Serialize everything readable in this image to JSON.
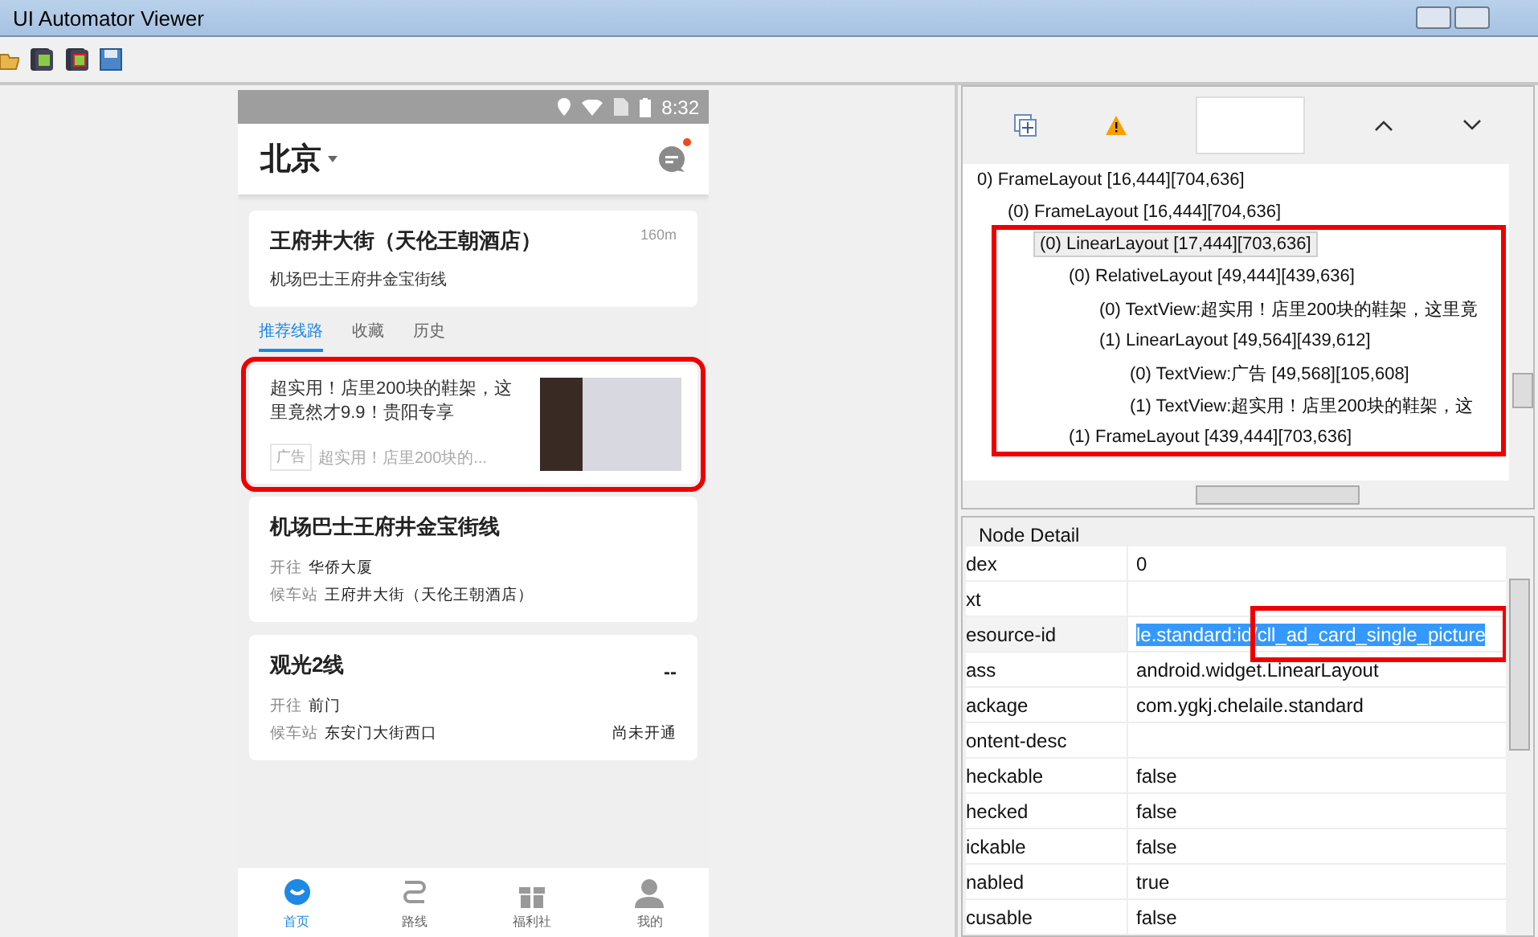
{
  "window": {
    "title": "UI Automator Viewer"
  },
  "phone": {
    "status_time": "8:32",
    "city": "北京",
    "has_notification": true,
    "nearby": {
      "stop": "王府井大街（天伦王朝酒店）",
      "distance": "160m",
      "line": "机场巴士王府井金宝街线"
    },
    "tabs": [
      {
        "label": "推荐线路",
        "selected": true
      },
      {
        "label": "收藏",
        "selected": false
      },
      {
        "label": "历史",
        "selected": false
      }
    ],
    "ad": {
      "title": "超实用！店里200块的鞋架，这里竟然才9.9！贵阳专享",
      "tag": "广告",
      "summary": "超实用！店里200块的...",
      "highlighted": true
    },
    "lines": [
      {
        "name": "机场巴士王府井金宝街线",
        "to_label": "开往",
        "to": "华侨大厦",
        "stop_label": "候车站",
        "stop": "王府井大街（天伦王朝酒店）"
      },
      {
        "name": "观光2线",
        "eta": "--",
        "to_label": "开往",
        "to": "前门",
        "stop_label": "候车站",
        "stop": "东安门大街西口",
        "status": "尚未开通"
      }
    ],
    "nav": [
      {
        "label": "首页",
        "selected": true
      },
      {
        "label": "路线",
        "selected": false
      },
      {
        "label": "福利社",
        "selected": false
      },
      {
        "label": "我的",
        "selected": false
      }
    ]
  },
  "tree": {
    "highlighted": true,
    "nodes": [
      {
        "label": "0) FrameLayout [16,444][704,636]",
        "selected": false,
        "children": [
          {
            "label": "(0) FrameLayout [16,444][704,636]",
            "selected": false,
            "children": [
              {
                "label": "(0) LinearLayout [17,444][703,636]",
                "selected": true,
                "children": [
                  {
                    "label": "(0) RelativeLayout [49,444][439,636]",
                    "selected": false,
                    "children": [
                      {
                        "label": "(0) TextView:超实用！店里200块的鞋架，这里竟",
                        "selected": false
                      },
                      {
                        "label": "(1) LinearLayout [49,564][439,612]",
                        "selected": false,
                        "children": [
                          {
                            "label": "(0) TextView:广告 [49,568][105,608]",
                            "selected": false
                          },
                          {
                            "label": "(1) TextView:超实用！店里200块的鞋架，这",
                            "selected": false
                          }
                        ]
                      }
                    ]
                  },
                  {
                    "label": "(1) FrameLayout [439,444][703,636]",
                    "selected": false
                  }
                ]
              }
            ]
          }
        ]
      }
    ]
  },
  "node_detail": {
    "title": "Node Detail",
    "rows": [
      {
        "key": "dex",
        "value": "0",
        "selected": false
      },
      {
        "key": "xt",
        "value": "",
        "selected": false
      },
      {
        "key": "esource-id",
        "value": "le.standard:id/cll_ad_card_single_picture",
        "selected": true,
        "highlighted": true
      },
      {
        "key": "ass",
        "value": "android.widget.LinearLayout",
        "selected": false
      },
      {
        "key": "ackage",
        "value": "com.ygkj.chelaile.standard",
        "selected": false
      },
      {
        "key": "ontent-desc",
        "value": "",
        "selected": false
      },
      {
        "key": "heckable",
        "value": "false",
        "selected": false
      },
      {
        "key": "hecked",
        "value": "false",
        "selected": false
      },
      {
        "key": "ickable",
        "value": "false",
        "selected": false
      },
      {
        "key": "nabled",
        "value": "true",
        "selected": false
      },
      {
        "key": "cusable",
        "value": "false",
        "selected": false
      }
    ]
  }
}
